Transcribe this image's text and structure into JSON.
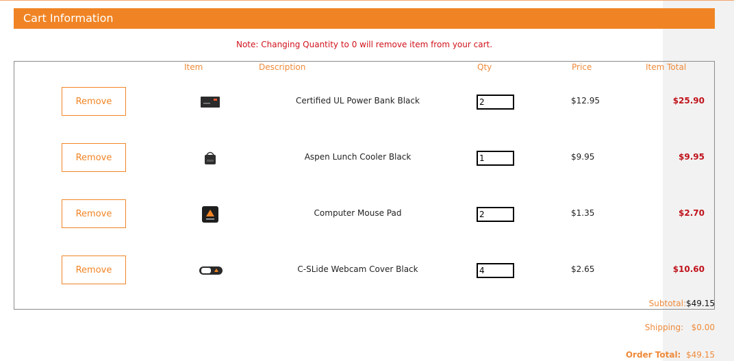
{
  "header": {
    "title": "Cart Information"
  },
  "note": "Note:  Changing Quantity to 0 will remove item from your cart.",
  "columns": {
    "item": "Item",
    "description": "Description",
    "qty": "Qty",
    "price": "Price",
    "item_total": "Item Total"
  },
  "items": [
    {
      "remove_label": "Remove",
      "description": "Certified UL Power Bank Black",
      "qty": "2",
      "price": "$12.95",
      "total": "$25.90",
      "icon": "power-bank-icon"
    },
    {
      "remove_label": "Remove",
      "description": "Aspen Lunch Cooler Black",
      "qty": "1",
      "price": "$9.95",
      "total": "$9.95",
      "icon": "lunch-cooler-icon"
    },
    {
      "remove_label": "Remove",
      "description": "Computer Mouse Pad",
      "qty": "2",
      "price": "$1.35",
      "total": "$2.70",
      "icon": "mouse-pad-icon"
    },
    {
      "remove_label": "Remove",
      "description": "C-SLide Webcam Cover Black",
      "qty": "4",
      "price": "$2.65",
      "total": "$10.60",
      "icon": "webcam-cover-icon"
    }
  ],
  "summary": {
    "subtotal_label": "Subtotal:",
    "subtotal_value": "$49.15",
    "shipping_label": "Shipping:",
    "shipping_value": "$0.00",
    "order_total_label": "Order Total:",
    "order_total_value": "$49.15"
  },
  "colors": {
    "accent": "#f08424",
    "note_red": "#d0121b",
    "total_red": "#c0121b"
  }
}
